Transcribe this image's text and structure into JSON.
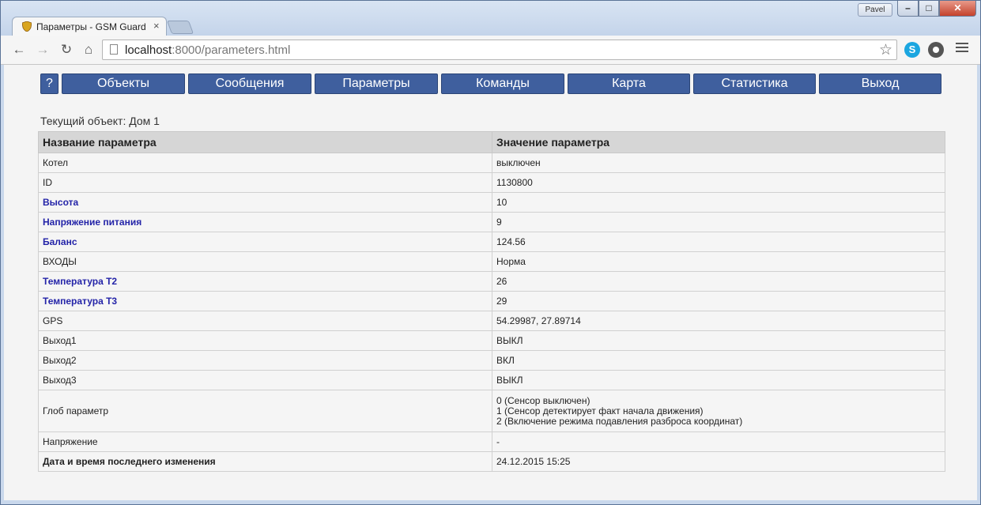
{
  "browser": {
    "tab_title": "Параметры - GSM Guard",
    "tab_close": "×",
    "profile_name": "Pavel",
    "url_host": "localhost",
    "url_rest": ":8000/parameters.html"
  },
  "nav": {
    "help": "?",
    "items": [
      "Объекты",
      "Сообщения",
      "Параметры",
      "Команды",
      "Карта",
      "Статистика",
      "Выход"
    ]
  },
  "current_object": "Текущий объект: Дом 1",
  "table": {
    "headers": [
      "Название параметра",
      "Значение параметра"
    ],
    "rows": [
      {
        "name": "Котел",
        "value": "выключен"
      },
      {
        "name": "ID",
        "value": "1130800"
      },
      {
        "name": "Высота",
        "value": "10"
      },
      {
        "name": "Напряжение питания",
        "value": "9"
      },
      {
        "name": "Баланс",
        "value": "124.56"
      },
      {
        "name": "ВХОДЫ",
        "value": "Норма"
      },
      {
        "name": "Температура Т2",
        "value": "26"
      },
      {
        "name": "Температура Т3",
        "value": "29"
      },
      {
        "name": "GPS",
        "value": "54.29987, 27.89714"
      },
      {
        "name": "Выход1",
        "value": "ВЫКЛ"
      },
      {
        "name": "Выход2",
        "value": "ВКЛ"
      },
      {
        "name": "Выход3",
        "value": "ВЫКЛ"
      },
      {
        "name": "Глоб параметр",
        "value_lines": [
          "0 (Сенсор выключен)",
          "1 (Сенсор детектирует факт начала движения)",
          "2 (Включение режима подавления разброса координат)"
        ]
      },
      {
        "name": "Напряжение",
        "value": "-"
      },
      {
        "name": "Дата и время последнего изменения",
        "value": "24.12.2015 15:25"
      }
    ]
  },
  "colors": {
    "nav_button": "#3f5f9e",
    "link_text": "#2424a8",
    "header_bg": "#d6d6d6"
  }
}
